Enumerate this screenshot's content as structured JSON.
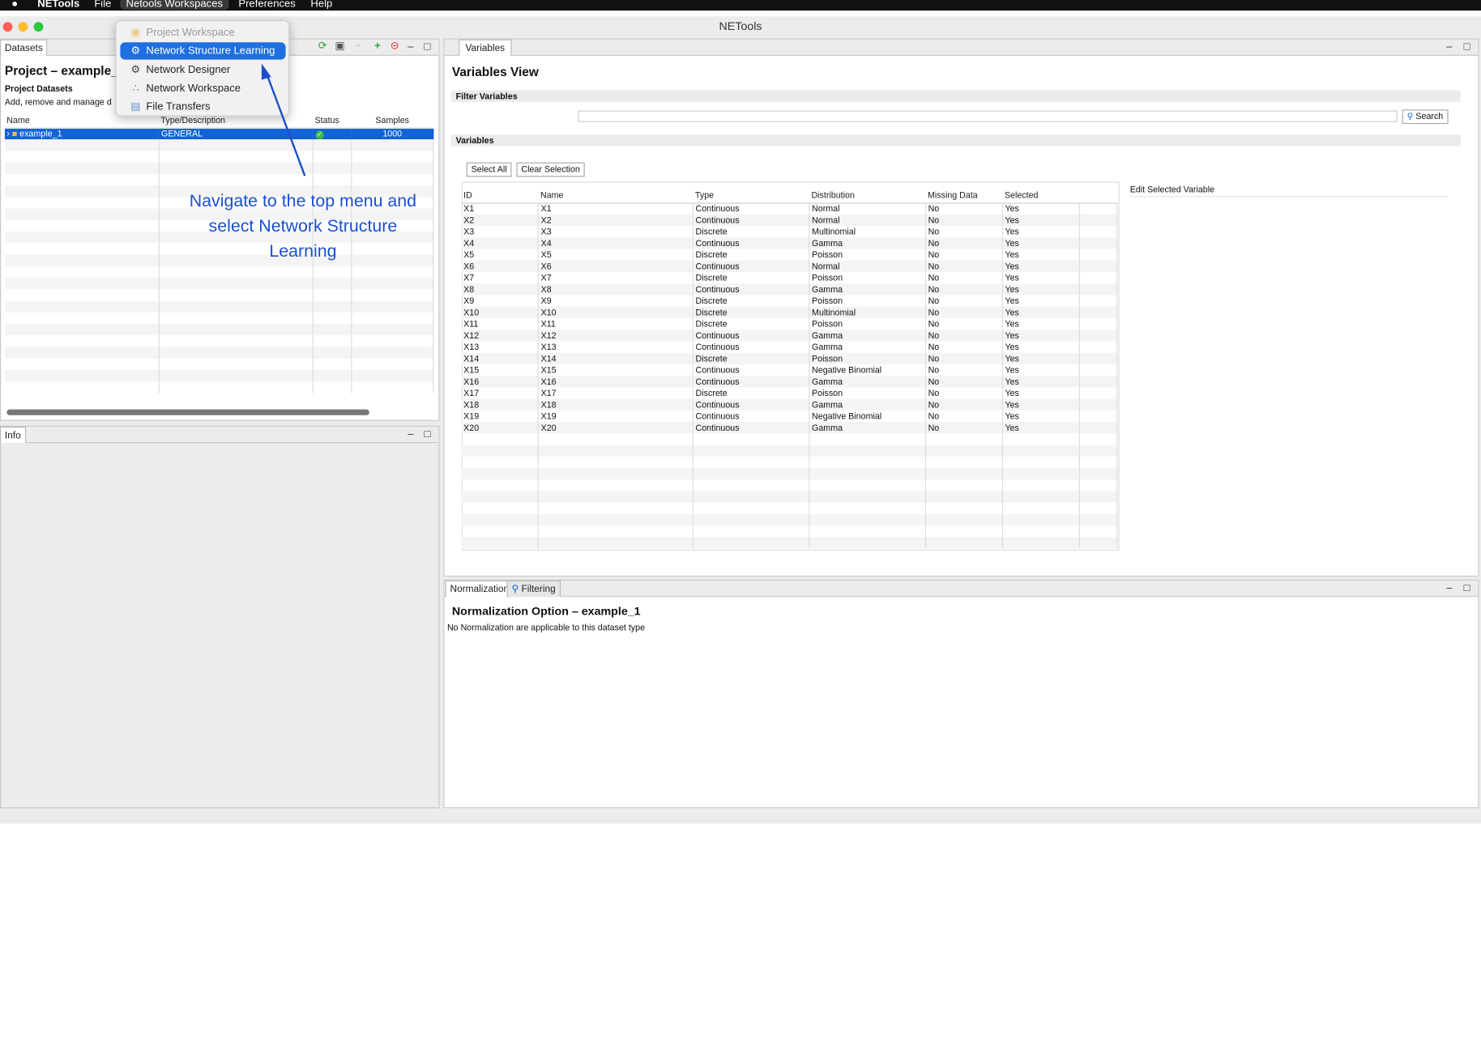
{
  "menubar": {
    "app_name": "NETools",
    "items": [
      "File",
      "Netools Workspaces",
      "Preferences",
      "Help"
    ]
  },
  "window": {
    "title": "NETools"
  },
  "workspace_menu": {
    "items": [
      {
        "label": "Project Workspace",
        "icon": "project-icon",
        "state": "disabled"
      },
      {
        "label": "Network Structure Learning",
        "icon": "gear-icon",
        "state": "highlighted"
      },
      {
        "label": "Network Designer",
        "icon": "gear-icon",
        "state": "normal"
      },
      {
        "label": "Network Workspace",
        "icon": "network-icon",
        "state": "normal"
      },
      {
        "label": "File Transfers",
        "icon": "file-icon",
        "state": "normal"
      }
    ]
  },
  "annotation": {
    "text": "Navigate to the top menu and select Network Structure Learning"
  },
  "datasets_panel": {
    "tab": "Datasets",
    "project_title": "Project – example_d",
    "section_title": "Project Datasets",
    "section_desc": "Add, remove and manage d",
    "columns": [
      "Name",
      "Type/Description",
      "Status",
      "Samples"
    ],
    "rows": [
      {
        "name": "example_1",
        "type": "GENERAL",
        "status": "ok",
        "samples": "1000"
      }
    ]
  },
  "info_panel": {
    "tab": "Info"
  },
  "variables_panel": {
    "tab": "Variables",
    "title": "Variables View",
    "filter_title": "Filter Variables",
    "search_label": "Search",
    "variables_title": "Variables",
    "select_all": "Select All",
    "clear_selection": "Clear Selection",
    "edit_title": "Edit Selected Variable",
    "columns": [
      "ID",
      "Name",
      "Type",
      "Distribution",
      "Missing Data",
      "Selected"
    ],
    "rows": [
      [
        "X1",
        "X1",
        "Continuous",
        "Normal",
        "No",
        "Yes"
      ],
      [
        "X2",
        "X2",
        "Continuous",
        "Normal",
        "No",
        "Yes"
      ],
      [
        "X3",
        "X3",
        "Discrete",
        "Multinomial",
        "No",
        "Yes"
      ],
      [
        "X4",
        "X4",
        "Continuous",
        "Gamma",
        "No",
        "Yes"
      ],
      [
        "X5",
        "X5",
        "Discrete",
        "Poisson",
        "No",
        "Yes"
      ],
      [
        "X6",
        "X6",
        "Continuous",
        "Normal",
        "No",
        "Yes"
      ],
      [
        "X7",
        "X7",
        "Discrete",
        "Poisson",
        "No",
        "Yes"
      ],
      [
        "X8",
        "X8",
        "Continuous",
        "Gamma",
        "No",
        "Yes"
      ],
      [
        "X9",
        "X9",
        "Discrete",
        "Poisson",
        "No",
        "Yes"
      ],
      [
        "X10",
        "X10",
        "Discrete",
        "Multinomial",
        "No",
        "Yes"
      ],
      [
        "X11",
        "X11",
        "Discrete",
        "Poisson",
        "No",
        "Yes"
      ],
      [
        "X12",
        "X12",
        "Continuous",
        "Gamma",
        "No",
        "Yes"
      ],
      [
        "X13",
        "X13",
        "Continuous",
        "Gamma",
        "No",
        "Yes"
      ],
      [
        "X14",
        "X14",
        "Discrete",
        "Poisson",
        "No",
        "Yes"
      ],
      [
        "X15",
        "X15",
        "Continuous",
        "Negative Binomial",
        "No",
        "Yes"
      ],
      [
        "X16",
        "X16",
        "Continuous",
        "Gamma",
        "No",
        "Yes"
      ],
      [
        "X17",
        "X17",
        "Discrete",
        "Poisson",
        "No",
        "Yes"
      ],
      [
        "X18",
        "X18",
        "Continuous",
        "Gamma",
        "No",
        "Yes"
      ],
      [
        "X19",
        "X19",
        "Continuous",
        "Negative Binomial",
        "No",
        "Yes"
      ],
      [
        "X20",
        "X20",
        "Continuous",
        "Gamma",
        "No",
        "Yes"
      ]
    ]
  },
  "bottom_panel": {
    "tabs": [
      "Normalization",
      "Filtering"
    ],
    "title": "Normalization Option – example_1",
    "message": "No Normalization are applicable to this dataset type"
  },
  "colors": {
    "selection": "#1163d6",
    "menu_highlight": "#1f6fe0",
    "annotation": "#1a4ecf"
  }
}
